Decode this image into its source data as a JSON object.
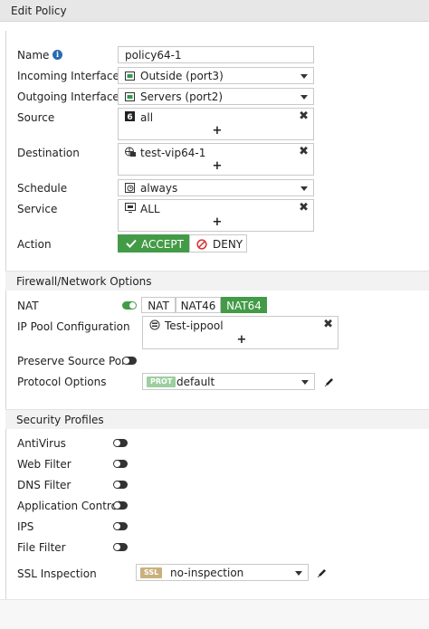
{
  "window": {
    "title": "Edit Policy"
  },
  "policy": {
    "name_label": "Name",
    "name_value": "policy64-1",
    "incoming_label": "Incoming Interface",
    "incoming_value": "Outside (port3)",
    "outgoing_label": "Outgoing Interface",
    "outgoing_value": "Servers (port2)",
    "source_label": "Source",
    "source_value": "all",
    "destination_label": "Destination",
    "destination_value": "test-vip64-1",
    "schedule_label": "Schedule",
    "schedule_value": "always",
    "service_label": "Service",
    "service_value": "ALL",
    "action_label": "Action",
    "accept_label": "ACCEPT",
    "deny_label": "DENY",
    "action_selected": "ACCEPT"
  },
  "firewall": {
    "section_title": "Firewall/Network Options",
    "nat_label": "NAT",
    "nat_enabled": true,
    "nat_options": [
      "NAT",
      "NAT46",
      "NAT64"
    ],
    "nat_selected": "NAT64",
    "ippool_label": "IP Pool Configuration",
    "ippool_value": "Test-ippool",
    "preserve_label": "Preserve Source Port",
    "preserve_enabled": false,
    "protocol_label": "Protocol Options",
    "protocol_badge": "PROT",
    "protocol_value": "default"
  },
  "security": {
    "section_title": "Security Profiles",
    "profiles": [
      {
        "label": "AntiVirus",
        "enabled": false
      },
      {
        "label": "Web Filter",
        "enabled": false
      },
      {
        "label": "DNS Filter",
        "enabled": false
      },
      {
        "label": "Application Control",
        "enabled": false
      },
      {
        "label": "IPS",
        "enabled": false
      },
      {
        "label": "File Filter",
        "enabled": false
      }
    ],
    "ssl_label": "SSL Inspection",
    "ssl_badge": "SSL",
    "ssl_value": "no-inspection"
  },
  "glyphs": {
    "remove": "✖",
    "add": "+"
  },
  "colors": {
    "accent_green": "#439b47",
    "protocol_badge": "#9ccf9f",
    "ssl_badge": "#c9b07d",
    "info_blue": "#2a6ab3"
  }
}
